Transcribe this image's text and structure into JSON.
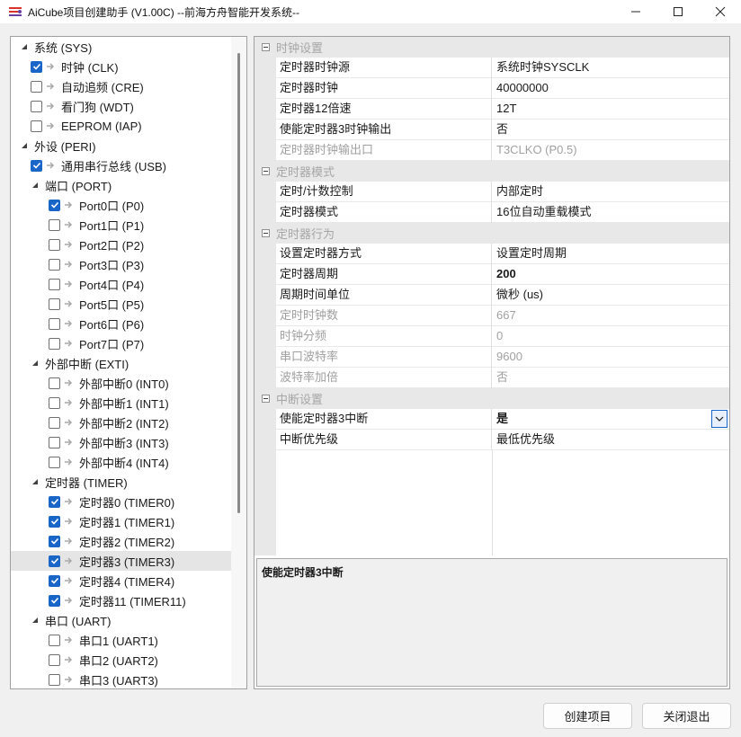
{
  "window": {
    "title": "AiCube项目创建助手 (V1.00C) --前海方舟智能开发系统--",
    "icons": {
      "app": "aicube-logo-icon",
      "minimize": "minimize-icon",
      "maximize": "maximize-icon",
      "close": "close-icon"
    }
  },
  "tree": {
    "items": [
      {
        "label": "系统 (SYS)",
        "level": 0,
        "expander": "expanded"
      },
      {
        "label": "时钟 (CLK)",
        "level": 1,
        "checked": true
      },
      {
        "label": "自动追频 (CRE)",
        "level": 1,
        "checked": false
      },
      {
        "label": "看门狗 (WDT)",
        "level": 1,
        "checked": false
      },
      {
        "label": "EEPROM (IAP)",
        "level": 1,
        "checked": false
      },
      {
        "label": "外设 (PERI)",
        "level": 0,
        "expander": "expanded"
      },
      {
        "label": "通用串行总线 (USB)",
        "level": 1,
        "checked": true
      },
      {
        "label": "端口 (PORT)",
        "level": 1,
        "expander": "expanded"
      },
      {
        "label": "Port0口 (P0)",
        "level": 2,
        "checked": true
      },
      {
        "label": "Port1口 (P1)",
        "level": 2,
        "checked": false
      },
      {
        "label": "Port2口 (P2)",
        "level": 2,
        "checked": false
      },
      {
        "label": "Port3口 (P3)",
        "level": 2,
        "checked": false
      },
      {
        "label": "Port4口 (P4)",
        "level": 2,
        "checked": false
      },
      {
        "label": "Port5口 (P5)",
        "level": 2,
        "checked": false
      },
      {
        "label": "Port6口 (P6)",
        "level": 2,
        "checked": false
      },
      {
        "label": "Port7口 (P7)",
        "level": 2,
        "checked": false
      },
      {
        "label": "外部中断 (EXTI)",
        "level": 1,
        "expander": "expanded"
      },
      {
        "label": "外部中断0 (INT0)",
        "level": 2,
        "checked": false
      },
      {
        "label": "外部中断1 (INT1)",
        "level": 2,
        "checked": false
      },
      {
        "label": "外部中断2 (INT2)",
        "level": 2,
        "checked": false
      },
      {
        "label": "外部中断3 (INT3)",
        "level": 2,
        "checked": false
      },
      {
        "label": "外部中断4 (INT4)",
        "level": 2,
        "checked": false
      },
      {
        "label": "定时器 (TIMER)",
        "level": 1,
        "expander": "expanded"
      },
      {
        "label": "定时器0 (TIMER0)",
        "level": 2,
        "checked": true
      },
      {
        "label": "定时器1 (TIMER1)",
        "level": 2,
        "checked": true
      },
      {
        "label": "定时器2 (TIMER2)",
        "level": 2,
        "checked": true
      },
      {
        "label": "定时器3 (TIMER3)",
        "level": 2,
        "checked": true,
        "selected": true
      },
      {
        "label": "定时器4 (TIMER4)",
        "level": 2,
        "checked": true
      },
      {
        "label": "定时器11 (TIMER11)",
        "level": 2,
        "checked": true
      },
      {
        "label": "串口 (UART)",
        "level": 1,
        "expander": "expanded"
      },
      {
        "label": "串口1 (UART1)",
        "level": 2,
        "checked": false
      },
      {
        "label": "串口2 (UART2)",
        "level": 2,
        "checked": false
      },
      {
        "label": "串口3 (UART3)",
        "level": 2,
        "checked": false
      }
    ]
  },
  "properties": {
    "categories": [
      {
        "label": "时钟设置",
        "rows": [
          {
            "name": "定时器时钟源",
            "value": "系统时钟SYSCLK"
          },
          {
            "name": "定时器时钟",
            "value": "40000000"
          },
          {
            "name": "定时器12倍速",
            "value": "12T"
          },
          {
            "name": "使能定时器3时钟输出",
            "value": "否"
          },
          {
            "name": "定时器时钟输出口",
            "value": "T3CLKO (P0.5)",
            "disabled": true
          }
        ]
      },
      {
        "label": "定时器模式",
        "rows": [
          {
            "name": "定时/计数控制",
            "value": "内部定时"
          },
          {
            "name": "定时器模式",
            "value": "16位自动重载模式"
          }
        ]
      },
      {
        "label": "定时器行为",
        "rows": [
          {
            "name": "设置定时器方式",
            "value": "设置定时周期"
          },
          {
            "name": "定时器周期",
            "value": "200",
            "bold": true
          },
          {
            "name": "周期时间单位",
            "value": "微秒 (us)"
          },
          {
            "name": "定时时钟数",
            "value": "667",
            "disabled": true
          },
          {
            "name": "时钟分频",
            "value": "0",
            "disabled": true
          },
          {
            "name": "串口波特率",
            "value": "9600",
            "disabled": true
          },
          {
            "name": "波特率加倍",
            "value": "否",
            "disabled": true
          }
        ]
      },
      {
        "label": "中断设置",
        "rows": [
          {
            "name": "使能定时器3中断",
            "value": "是",
            "bold": true,
            "dropdown": true
          },
          {
            "name": "中断优先级",
            "value": "最低优先级"
          }
        ]
      }
    ],
    "description_title": "使能定时器3中断"
  },
  "buttons": {
    "create": "创建项目",
    "close": "关闭退出"
  },
  "colors": {
    "accent": "#1a66c8",
    "category_bg": "#e8e8e8",
    "disabled_text": "#a0a0a0"
  }
}
